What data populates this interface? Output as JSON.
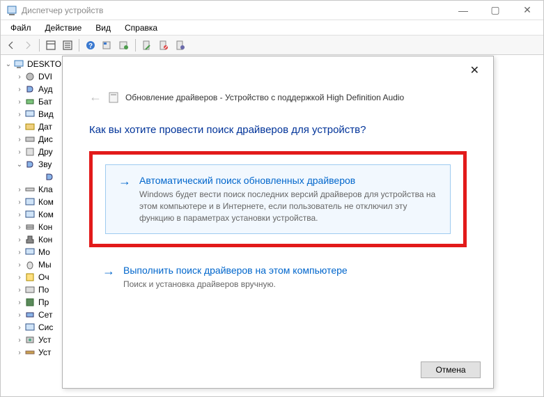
{
  "window": {
    "title": "Диспетчер устройств",
    "controls": {
      "min": "—",
      "max": "▢",
      "close": "✕"
    }
  },
  "menu": [
    "Файл",
    "Действие",
    "Вид",
    "Справка"
  ],
  "tree": {
    "root": "DESKTO",
    "items": [
      "DVI",
      "Ауд",
      "Бат",
      "Вид",
      "Дат",
      "Дис",
      "Дру",
      "Зву",
      "",
      "Кла",
      "Ком",
      "Ком",
      "Кон",
      "Кон",
      "Мо",
      "Мы",
      "Оч",
      "По",
      "Пр",
      "Сет",
      "Сис",
      "Уст",
      "Уст"
    ],
    "child": ""
  },
  "toolbar_icons": [
    "back",
    "forward",
    "frame",
    "frame2",
    "help",
    "refresh",
    "stop",
    "update",
    "scan",
    "wizard"
  ],
  "dialog": {
    "title": "Обновление драйверов - Устройство с поддержкой High Definition Audio",
    "question": "Как вы хотите провести поиск драйверов для устройств?",
    "option1": {
      "title": "Автоматический поиск обновленных драйверов",
      "desc": "Windows будет вести поиск последних версий драйверов для устройства на этом компьютере и в Интернете, если пользователь не отключил эту функцию в параметрах установки устройства."
    },
    "option2": {
      "title": "Выполнить поиск драйверов на этом компьютере",
      "desc": "Поиск и установка драйверов вручную."
    },
    "cancel": "Отмена",
    "close": "✕",
    "back": "←"
  }
}
